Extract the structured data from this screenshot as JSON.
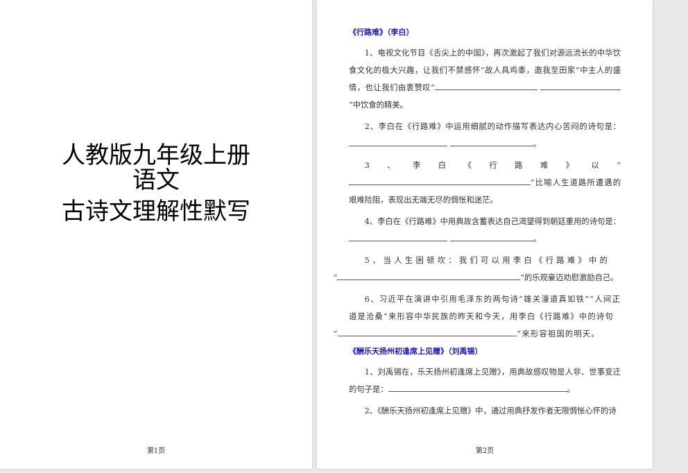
{
  "page1": {
    "title_lines": [
      "人教版九年级上册",
      "语文",
      "古诗文理解性默写"
    ],
    "page_label": "第1页"
  },
  "page2": {
    "page_label": "第2页",
    "section1_title": "《行路难》（李白）",
    "q1": {
      "a": "1、电视文化节目《舌尖上的中国》，再次激起了我们对源远流长的中华饮食文化的极大兴趣，让我们不禁感怀“故人具鸡黍，邀我至田家”中主人的盛情，也让我们由衷赞叹“",
      "b": "”中饮食的精美。"
    },
    "q2": {
      "a": "2、李白在《行路难》中运用细腻的动作描写表达内心苦闷的诗句是：",
      "b": "。"
    },
    "q3": {
      "a": "3、李白《行路难》以“",
      "b": "”比喻人生道路所遭遇的艰难险阻，表现出无端无尽的惆怅和迷茫。"
    },
    "q4": {
      "a": "4、李白在《行路难》中用典故含蓄表达自己渴望得到朝廷重用的诗句是：",
      "b": "。"
    },
    "q5": {
      "a": "5、当人生困顿坎：我们可以用李白《行路难》中的",
      "b": "“",
      "c": "”的乐观豪迈劝慰激励自己。"
    },
    "q6": {
      "a": "6、习近平在演讲中引用毛泽东的两句诗“雄关漫道真如铁”“人间正道是沧桑”来形容中华民族的昨天和今天，用李白《行路难》中的诗句",
      "b": "“",
      "c": "”来形容祖国的明天。"
    },
    "section2_title": "《酬乐天扬州初逢席上见赠》（刘禹锡）",
    "q7": {
      "a": "1、刘禹锡在，乐天扬州初逢席上见赠》，用典故感叹物是人非、世事变迁的句子是：",
      "b": "。"
    },
    "q8": {
      "a": "2、《酬乐天扬州初逢席上见赠》中，通过用典抒发作者无限惆怅心怀的诗"
    }
  }
}
